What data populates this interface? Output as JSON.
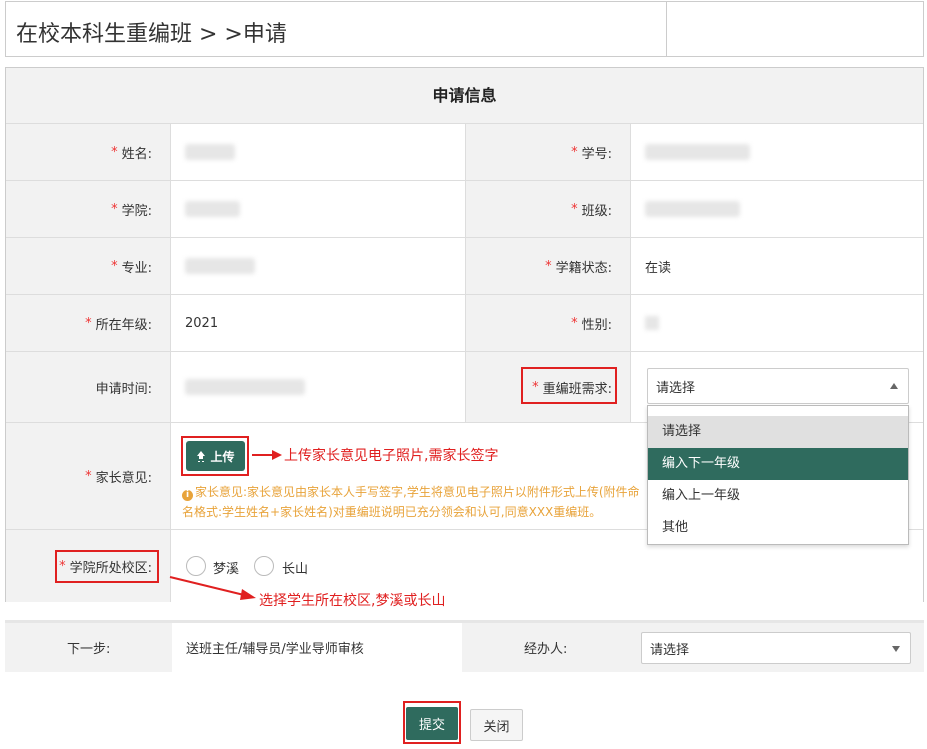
{
  "page": {
    "title": "在校本科生重编班 > >申请"
  },
  "panel": {
    "heading": "申请信息"
  },
  "fields": {
    "name_label": "姓名:",
    "student_id_label": "学号:",
    "college_label": "学院:",
    "class_label": "班级:",
    "major_label": "专业:",
    "status_label": "学籍状态:",
    "status_value": "在读",
    "grade_label": "所在年级:",
    "grade_value": "2021",
    "gender_label": "性别:",
    "apply_time_label": "申请时间:",
    "regroup_label": "重编班需求:",
    "regroup_placeholder": "请选择",
    "parent_label": "家长意见:",
    "upload_label": "上传",
    "parent_hint_icon": "i",
    "parent_hint": "家长意见:家长意见由家长本人手写签字,学生将意见电子照片以附件形式上传(附件命名格式:学生姓名+家长姓名)对重编班说明已充分领会和认可,同意XXX重编班。",
    "campus_label": "学院所处校区:",
    "campus_options": [
      "梦溪",
      "长山"
    ],
    "required_mark": "*"
  },
  "dropdown": {
    "options": [
      "请选择",
      "编入下一年级",
      "编入上一年级",
      "其他"
    ],
    "highlighted_index": 0,
    "selected_index": 1
  },
  "annotations": {
    "upload_note": "上传家长意见电子照片,需家长签字",
    "campus_note": "选择学生所在校区,梦溪或长山"
  },
  "next_step": {
    "label": "下一步:",
    "value": "送班主任/辅导员/学业导师审核",
    "handler_label": "经办人:",
    "handler_placeholder": "请选择"
  },
  "actions": {
    "submit": "提交",
    "close": "关闭"
  },
  "colors": {
    "primary": "#2f6b5e",
    "required": "#e33333",
    "annotation": "#e02020",
    "hint": "#e8a33a"
  }
}
